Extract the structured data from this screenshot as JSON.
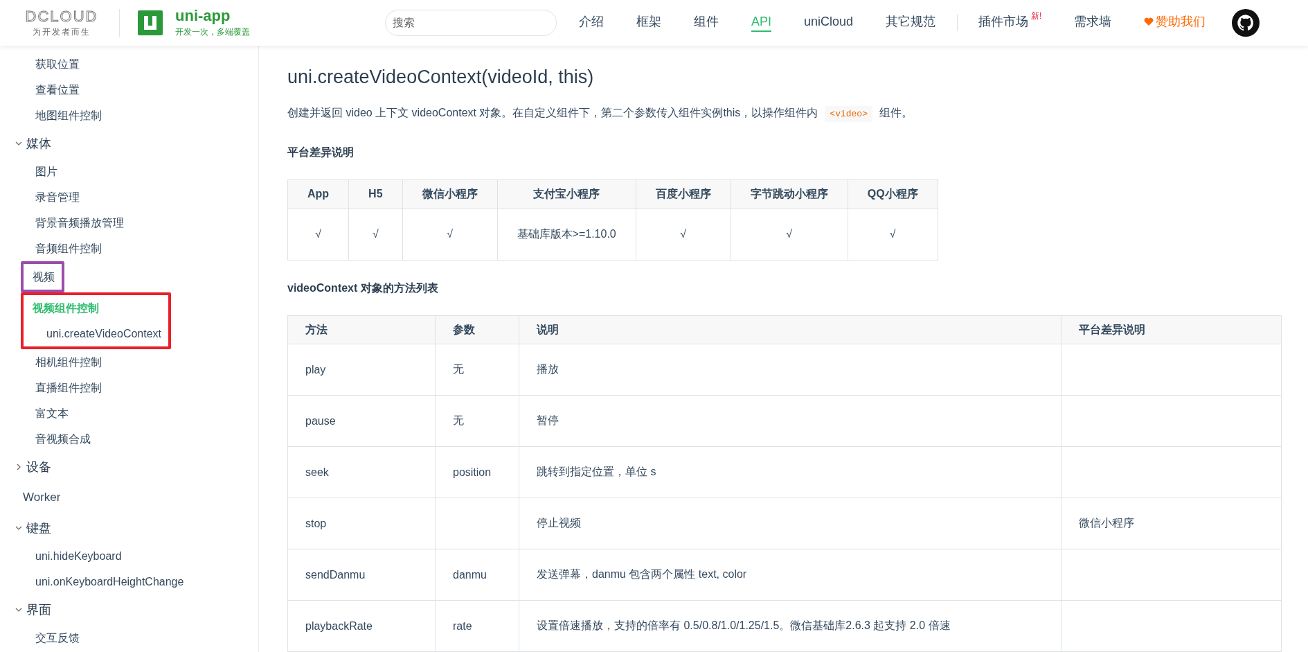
{
  "header": {
    "brand": {
      "wordmark": "DCLOUD",
      "slogan": "为开发者而生"
    },
    "product": {
      "name": "uni-app",
      "tagline": "开发一次，多端覆盖"
    },
    "search": {
      "placeholder": "搜索"
    },
    "nav": [
      {
        "label": "介绍",
        "selected": false
      },
      {
        "label": "框架",
        "selected": false
      },
      {
        "label": "组件",
        "selected": false
      },
      {
        "label": "API",
        "selected": true
      },
      {
        "label": "uniCloud",
        "selected": false
      },
      {
        "label": "其它规范",
        "selected": false
      },
      {
        "kind": "divider"
      },
      {
        "label": "插件市场",
        "selected": false,
        "badge": "新!"
      },
      {
        "label": "需求墙",
        "selected": false
      },
      {
        "kind": "sponsor",
        "label": "赞助我们",
        "selected": false
      },
      {
        "kind": "github"
      }
    ]
  },
  "sidebar": {
    "items": [
      {
        "kind": "continued",
        "children": [
          {
            "kind": "link",
            "label": "获取位置",
            "selected": false
          },
          {
            "kind": "link",
            "label": "查看位置",
            "selected": false
          },
          {
            "kind": "link",
            "label": "地图组件控制",
            "selected": false
          }
        ]
      },
      {
        "kind": "group",
        "label": "媒体",
        "expanded": true,
        "children": [
          {
            "kind": "link",
            "label": "图片",
            "selected": false
          },
          {
            "kind": "link",
            "label": "录音管理",
            "selected": false
          },
          {
            "kind": "link",
            "label": "背景音频播放管理",
            "selected": false
          },
          {
            "kind": "link",
            "label": "音频组件控制",
            "selected": false
          },
          {
            "kind": "frame",
            "color": "#9b4dab",
            "items": [
              {
                "kind": "link",
                "label": "视频",
                "selected": false
              }
            ]
          },
          {
            "kind": "frame",
            "color": "#e8202a",
            "items": [
              {
                "kind": "link",
                "label": "视频组件控制",
                "selected": true,
                "children": [
                  {
                    "kind": "link",
                    "label": "uni.createVideoContext",
                    "selected": false
                  }
                ]
              }
            ]
          },
          {
            "kind": "link",
            "label": "相机组件控制",
            "selected": false
          },
          {
            "kind": "link",
            "label": "直播组件控制",
            "selected": false
          },
          {
            "kind": "link",
            "label": "富文本",
            "selected": false
          },
          {
            "kind": "link",
            "label": "音视频合成",
            "selected": false
          }
        ]
      },
      {
        "kind": "group",
        "label": "设备",
        "expanded": false
      },
      {
        "kind": "link",
        "label": "Worker",
        "selected": false
      },
      {
        "kind": "group",
        "label": "键盘",
        "expanded": true,
        "children": [
          {
            "kind": "link",
            "label": "uni.hideKeyboard",
            "selected": false
          },
          {
            "kind": "link",
            "label": "uni.onKeyboardHeightChange",
            "selected": false
          }
        ]
      },
      {
        "kind": "group",
        "label": "界面",
        "expanded": true,
        "children": [
          {
            "kind": "link",
            "label": "交互反馈",
            "selected": false
          }
        ]
      }
    ]
  },
  "content": {
    "title": "uni.createVideoContext(videoId, this)",
    "intro": {
      "before": "创建并返回 video 上下文 videoContext 对象。在自定义组件下，第二个参数传入组件实例this，以操作组件内",
      "code": "<video>",
      "after": "组件。"
    },
    "platform_heading": "平台差异说明",
    "platform_table": {
      "columns": [
        "App",
        "H5",
        "微信小程序",
        "支付宝小程序",
        "百度小程序",
        "字节跳动小程序",
        "QQ小程序"
      ],
      "rows": [
        [
          "√",
          "√",
          "√",
          "基础库版本>=1.10.0",
          "√",
          "√",
          "√"
        ]
      ]
    },
    "methods_heading": "videoContext 对象的方法列表",
    "methods_table": {
      "columns": [
        "方法",
        "参数",
        "说明",
        "平台差异说明"
      ],
      "rows": [
        [
          "play",
          "无",
          "播放",
          ""
        ],
        [
          "pause",
          "无",
          "暂停",
          ""
        ],
        [
          "seek",
          "position",
          "跳转到指定位置，单位 s",
          ""
        ],
        [
          "stop",
          "",
          "停止视频",
          "微信小程序"
        ],
        [
          "sendDanmu",
          "danmu",
          "发送弹幕，danmu 包含两个属性 text, color",
          ""
        ],
        [
          "playbackRate",
          "rate",
          "设置倍速播放，支持的倍率有 0.5/0.8/1.0/1.25/1.5。微信基础库2.6.3 起支持 2.0 倍速",
          ""
        ]
      ]
    }
  }
}
